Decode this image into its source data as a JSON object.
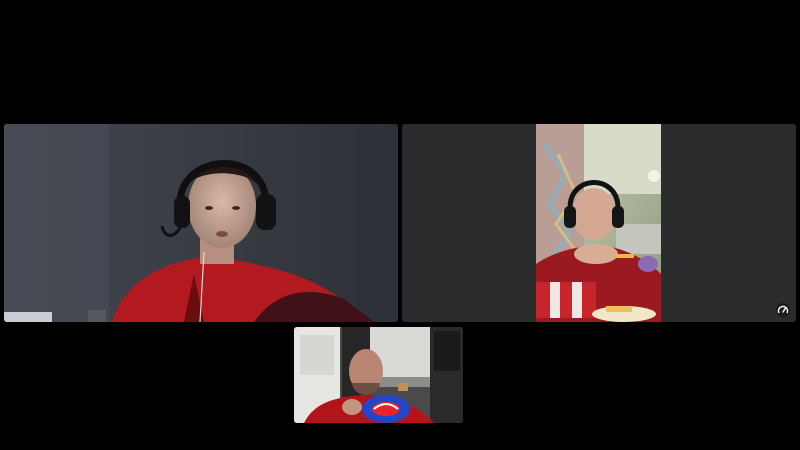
{
  "call": {
    "participant_count": 3
  },
  "tiles": [
    {
      "id": "participant-1",
      "feed": "webcam",
      "has_headset": true
    },
    {
      "id": "participant-2",
      "feed": "phone-portrait",
      "has_headset": true
    },
    {
      "id": "participant-3",
      "feed": "webcam",
      "has_headset": false
    }
  ],
  "controls": {
    "connection_stats_icon": "speedometer-icon"
  },
  "colors": {
    "background": "#000000",
    "tile_gray": "#2b2c2e",
    "shirt_red": "#b5161c",
    "accent_blue": "#2246c9"
  }
}
